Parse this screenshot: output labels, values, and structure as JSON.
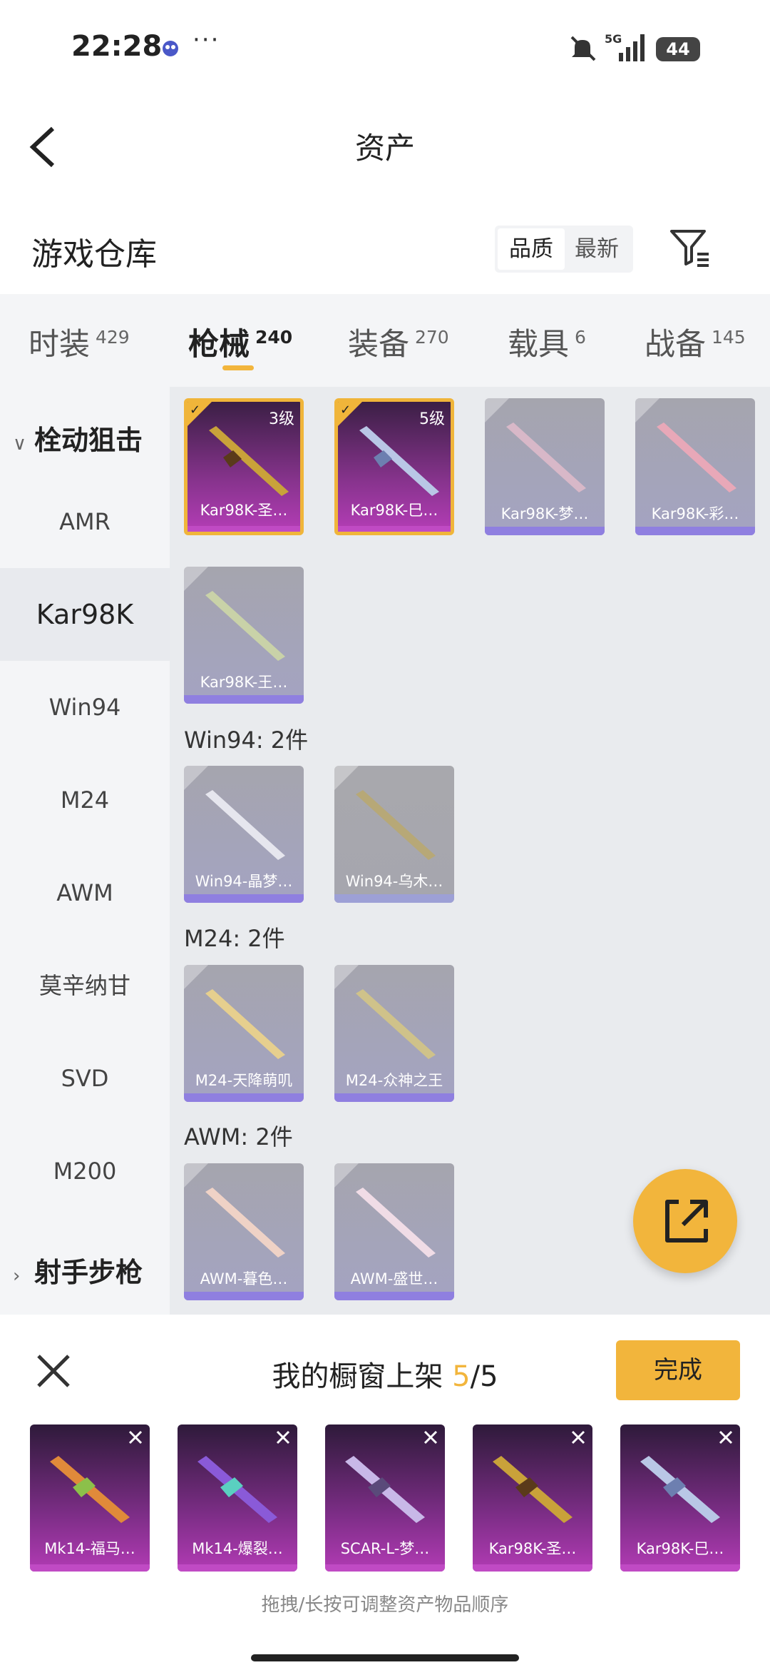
{
  "status_bar": {
    "time": "22:28",
    "more": "···",
    "signal": "5G",
    "battery": "44"
  },
  "header": {
    "title": "资产"
  },
  "section": {
    "title": "游戏仓库",
    "sort_options": [
      "品质",
      "最新"
    ],
    "selected_sort": "品质"
  },
  "tabs": [
    {
      "label": "时装",
      "count": "429"
    },
    {
      "label": "枪械",
      "count": "240",
      "active": true
    },
    {
      "label": "装备",
      "count": "270"
    },
    {
      "label": "载具",
      "count": "6"
    },
    {
      "label": "战备",
      "count": "145"
    }
  ],
  "sidebar": {
    "group_expanded": "栓动狙击",
    "items": [
      "AMR",
      "Kar98K",
      "Win94",
      "M24",
      "AWM",
      "莫辛纳甘",
      "SVD",
      "M200"
    ],
    "active_item": "Kar98K",
    "group_collapsed": "射手步枪"
  },
  "main": {
    "kar98k_cards": [
      {
        "label": "Kar98K-圣…",
        "level": "3级",
        "selected": true
      },
      {
        "label": "Kar98K-巳…",
        "level": "5级",
        "selected": true
      },
      {
        "label": "Kar98K-梦…",
        "selected": false
      },
      {
        "label": "Kar98K-彩…",
        "selected": false
      },
      {
        "label": "Kar98K-王…",
        "selected": false
      }
    ],
    "groups": [
      {
        "title": "Win94: 2件",
        "cards": [
          "Win94-晶梦…",
          "Win94-乌木…"
        ]
      },
      {
        "title": "M24: 2件",
        "cards": [
          "M24-天降萌叽",
          "M24-众神之王"
        ]
      },
      {
        "title": "AWM: 2件",
        "cards": [
          "AWM-暮色…",
          "AWM-盛世…"
        ]
      }
    ]
  },
  "bottom_panel": {
    "title_prefix": "我的橱窗上架 ",
    "current": "5",
    "separator": "/",
    "total": "5",
    "done_label": "完成",
    "shelf_items": [
      "Mk14-福马…",
      "Mk14-爆裂…",
      "SCAR-L-梦…",
      "Kar98K-圣…",
      "Kar98K-巳…"
    ],
    "hint": "拖拽/长按可调整资产物品顺序"
  },
  "colors": {
    "accent": "#f2b53c",
    "epic_purple": "#86338c",
    "card_grey": "#a5a5ae"
  }
}
